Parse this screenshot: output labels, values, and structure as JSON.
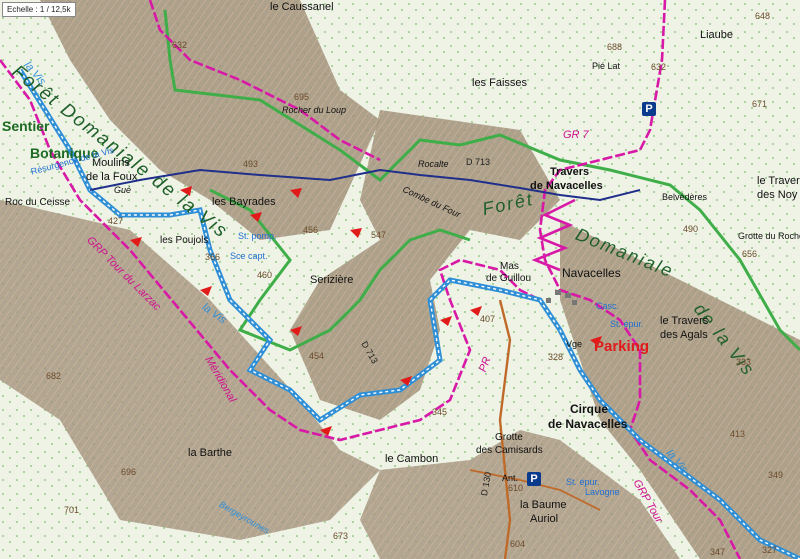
{
  "map": {
    "scale_label": "Echelle : 1 / 12,5k",
    "forest_titles": {
      "left": "Forêt Domaniale de la Vis",
      "right_a": "Forêt",
      "right_b": "Domaniale",
      "right_c": "de la Vis"
    },
    "places": {
      "caussanel": "le Caussanel",
      "faisses": "les Faisses",
      "pie_lat": "Pié Lat",
      "liaube": "Liaube",
      "rocher_loup": "Rocher du Loup",
      "rocalte": "Rocalte",
      "travers_navacelles_1": "Travers",
      "travers_navacelles_2": "de Navacelles",
      "moulins_1": "Moulins",
      "moulins_2": "de la Foux",
      "gue": "Gué",
      "roc_ceisse": "Roc du Ceisse",
      "bayrades": "les Bayrades",
      "poujols": "les Poujols",
      "serizière": "Serizière",
      "combe_four": "Combe du Four",
      "mas_guillou_1": "Mas",
      "mas_guillou_2": "de Guillou",
      "navacelles": "Navacelles",
      "travers_agals_1": "le Travers",
      "travers_agals_2": "des Agals",
      "travers_noy_1": "le Travers",
      "travers_noy_2": "des Noy",
      "belvederes": "Belvédères",
      "grotte_rocher": "Grotte du Rocher de Mi",
      "cirque_1": "Cirque",
      "cirque_2": "de Navacelles",
      "grotte_camisards_1": "Grotte",
      "grotte_camisards_2": "des Camisards",
      "cambon": "le Cambon",
      "barthe": "la Barthe",
      "baume_1": "la Baume",
      "baume_2": "Auriol",
      "lavogne": "Lavogne",
      "ant": "Ant.",
      "vge": "Vge",
      "sentier_1": "Sentier",
      "sentier_2": "Botanique",
      "parking": "Parking",
      "resurgence": "Résurgence de la Vis",
      "st_pomp": "St. pomp.",
      "sce_capt": "Sce capt.",
      "st_epur_1": "St. épur.",
      "st_epur_2": "St. épur.",
      "casc": "Casc."
    },
    "trails": {
      "grp_tour_larzac": "GRP Tour du Larzac",
      "meridional": "Méridional",
      "gr7": "GR 7",
      "grp_right": "GRP Tour",
      "pr": "PR"
    },
    "rivers": {
      "la_vis_left": "la Vis",
      "la_vis_mid": "la Vis",
      "la_vis_right": "la Vis",
      "bergeronnes": "Bergeyrounes"
    },
    "roads": {
      "d713_top": "D 713",
      "d713_mid": "D 713",
      "d130": "D 130"
    },
    "elevations": [
      "632",
      "695",
      "648",
      "688",
      "632",
      "671",
      "493",
      "456",
      "547",
      "427",
      "366",
      "460",
      "454",
      "345",
      "407",
      "328",
      "490",
      "656",
      "333",
      "682",
      "696",
      "701",
      "673",
      "610",
      "604",
      "413",
      "347",
      "349",
      "327"
    ],
    "parking_badges": [
      "P",
      "P"
    ],
    "colors": {
      "trail_magenta": "#d818a6",
      "forest_green": "#3fae49",
      "river_blue": "#2f8fd6",
      "road_navy": "#1f2f8a",
      "arrow_red": "#e11a1a",
      "relief": "#9a8a74"
    }
  }
}
